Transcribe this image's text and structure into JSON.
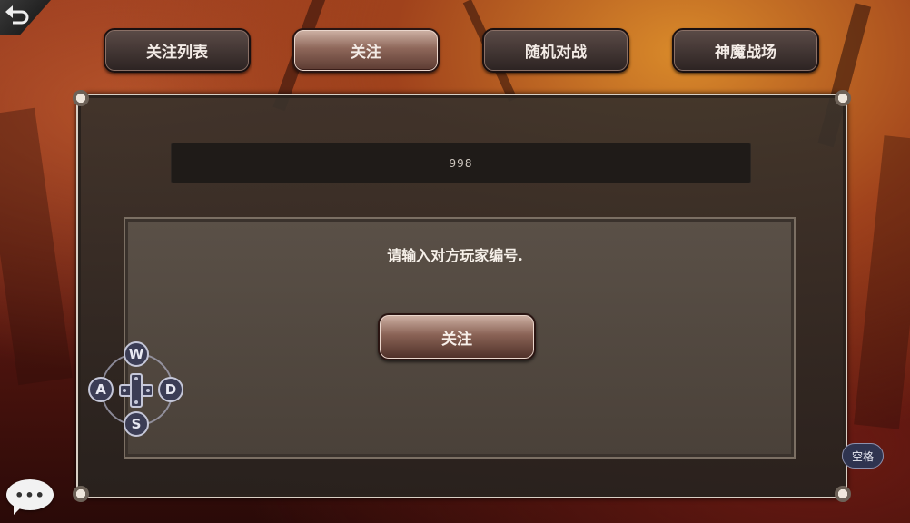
{
  "tabs": [
    {
      "label": "关注列表",
      "active": false
    },
    {
      "label": "关注",
      "active": true
    },
    {
      "label": "随机对战",
      "active": false
    },
    {
      "label": "神魔战场",
      "active": false
    }
  ],
  "id_field": {
    "value": "998"
  },
  "dialog": {
    "prompt": "请输入对方玩家编号.",
    "follow_button": "关注"
  },
  "dpad": {
    "up": "W",
    "left": "A",
    "right": "D",
    "down": "S"
  },
  "space_button": "空格",
  "chat_button": "•••",
  "icons": {
    "back": "back-arrow-icon",
    "chat": "chat-bubble-icon"
  }
}
